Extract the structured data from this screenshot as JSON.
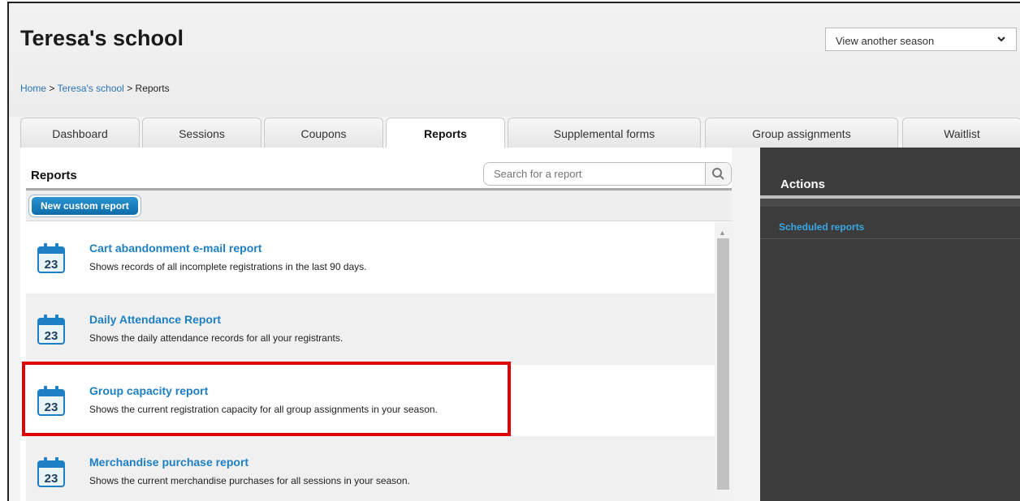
{
  "header": {
    "title": "Teresa's school",
    "season_select": "View another season"
  },
  "breadcrumb": {
    "home": "Home",
    "sep1": ">",
    "school": "Teresa's school",
    "sep2": ">",
    "current": "Reports"
  },
  "tabs": [
    {
      "label": "Dashboard"
    },
    {
      "label": "Sessions"
    },
    {
      "label": "Coupons"
    },
    {
      "label": "Reports",
      "active": true
    },
    {
      "label": "Supplemental forms"
    },
    {
      "label": "Group assignments"
    },
    {
      "label": "Waitlist"
    }
  ],
  "reports": {
    "heading": "Reports",
    "search_placeholder": "Search for a report",
    "new_button": "New custom report",
    "calendar_day": "23",
    "items": [
      {
        "title": "Cart abandonment e-mail report",
        "description": "Shows records of all incomplete registrations in the last 90 days."
      },
      {
        "title": "Daily Attendance Report",
        "description": "Shows the daily attendance records for all your registrants."
      },
      {
        "title": "Group capacity report",
        "description": "Shows the current registration capacity for all group assignments in your season."
      },
      {
        "title": "Merchandise purchase report",
        "description": "Shows the current merchandise purchases for all sessions in your season."
      }
    ]
  },
  "sidebar": {
    "title": "Actions",
    "link": "Scheduled reports"
  },
  "colors": {
    "link_blue": "#1d7fc4",
    "sidebar_bg": "#3c3c3c",
    "highlight_red": "#e00000",
    "button_blue": "#0d6ca8"
  }
}
